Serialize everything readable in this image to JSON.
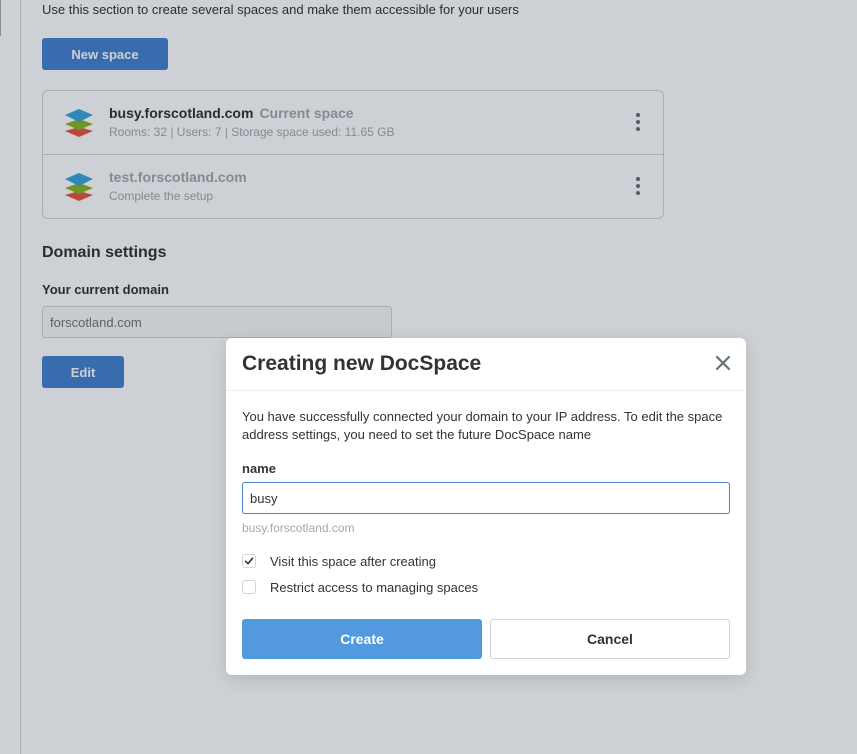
{
  "section": {
    "description": "Use this section to create several spaces and make them accessible for your users",
    "new_space_label": "New space"
  },
  "spaces": [
    {
      "name": "busy.forscotland.com",
      "current_label": "Current space",
      "meta": "Rooms: 32 | Users: 7 | Storage space used: 11.65 GB"
    },
    {
      "name": "test.forscotland.com",
      "meta": "Complete the setup"
    }
  ],
  "domain": {
    "title": "Domain settings",
    "label": "Your current domain",
    "placeholder": "forscotland.com",
    "edit_label": "Edit"
  },
  "modal": {
    "title": "Creating new DocSpace",
    "description": "You have successfully connected your domain to your IP address. To edit the space address settings, you need to set the future DocSpace name",
    "name_label": "name",
    "name_value": "busy",
    "domain_hint": "busy.forscotland.com",
    "checkbox_visit": {
      "label": "Visit this space after creating",
      "checked": true
    },
    "checkbox_restrict": {
      "label": "Restrict access to managing spaces",
      "checked": false
    },
    "create_label": "Create",
    "cancel_label": "Cancel"
  },
  "colors": {
    "primary": "#4781d1",
    "create_button": "#5299e0",
    "muted_text": "#a3a9ae",
    "logo_blue": "#3aa6d9",
    "logo_green": "#8bb825",
    "logo_red": "#e2583d"
  },
  "icons": {
    "space_logo": "layers-logo-icon",
    "kebab": "kebab-menu-icon",
    "close": "close-icon",
    "check": "check-icon"
  }
}
